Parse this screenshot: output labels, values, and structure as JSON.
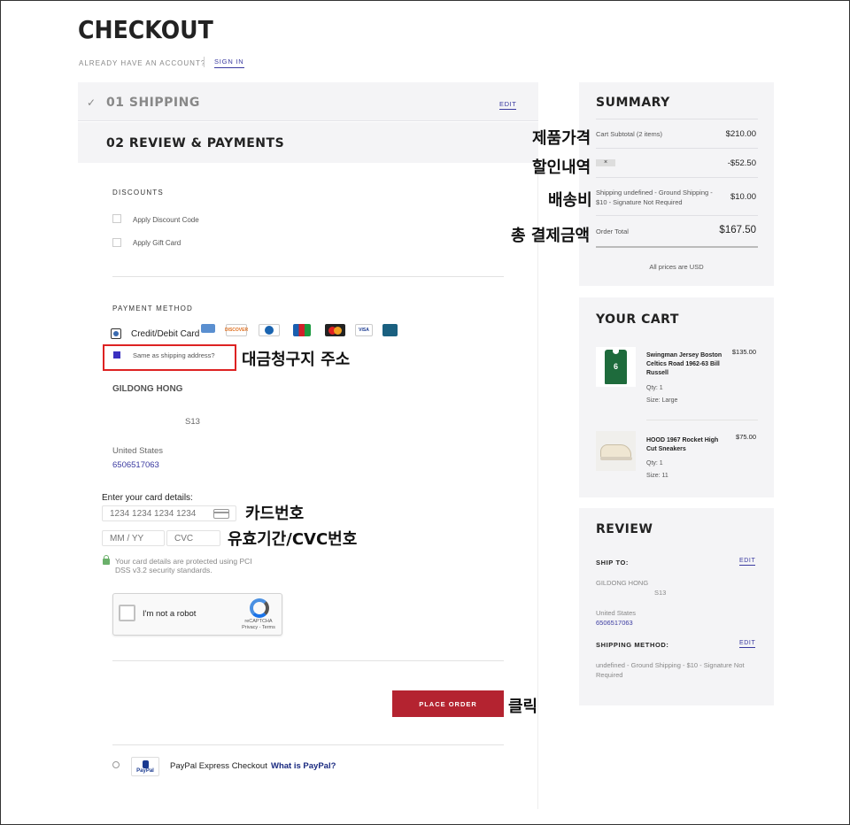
{
  "header": {
    "title": "CHECKOUT",
    "account_question": "ALREADY HAVE AN ACCOUNT?",
    "sign_in": "SIGN IN"
  },
  "steps": {
    "shipping": {
      "title": "01 SHIPPING",
      "edit": "EDIT"
    },
    "review": {
      "title": "02 REVIEW & PAYMENTS"
    }
  },
  "discounts": {
    "label": "DISCOUNTS",
    "options": [
      "Apply Discount Code",
      "Apply Gift Card"
    ]
  },
  "payment": {
    "label": "PAYMENT METHOD",
    "card_option": "Credit/Debit Card",
    "card_logos": [
      "amex",
      "DISCOVER",
      "diners",
      "jcb",
      "mastercard",
      "VISA",
      "cb"
    ],
    "same_as_shipping": "Same as shipping address?",
    "billing": {
      "name": "GILDONG HONG",
      "line": "S13",
      "country": "United States",
      "phone": "6506517063"
    },
    "card_details_label": "Enter your card details:",
    "card_number_placeholder": "1234 1234 1234 1234",
    "expiry_placeholder": "MM / YY",
    "cvc_placeholder": "CVC",
    "secure_text": "Your card details are protected using PCI DSS v3.2 security standards.",
    "captcha": {
      "label": "I'm not a robot",
      "brand": "reCAPTCHA",
      "links": "Privacy - Terms"
    },
    "place_order": "PLACE ORDER",
    "paypal": {
      "logo": "PayPal",
      "label": "PayPal Express Checkout",
      "link": "What is PayPal?"
    }
  },
  "summary": {
    "title": "SUMMARY",
    "rows": [
      {
        "label": "Cart Subtotal (2 items)",
        "value": "$210.00"
      },
      {
        "label": "×",
        "value": "-$52.50"
      },
      {
        "label": "Shipping undefined - Ground Shipping - $10 - Signature Not Required",
        "value": "$10.00"
      },
      {
        "label": "Order Total",
        "value": "$167.50"
      }
    ],
    "note": "All prices are USD"
  },
  "cart": {
    "title": "YOUR CART",
    "items": [
      {
        "name": "Swingman Jersey Boston Celtics Road 1962-63 Bill Russell",
        "price": "$135.00",
        "qty": "Qty: 1",
        "size": "Size: Large",
        "jersey_number": "6"
      },
      {
        "name": "HOOD 1967 Rocket High Cut Sneakers",
        "price": "$75.00",
        "qty": "Qty: 1",
        "size": "Size: 11"
      }
    ]
  },
  "review_panel": {
    "title": "REVIEW",
    "ship_to_label": "SHIP TO:",
    "edit": "EDIT",
    "ship_name": "GILDONG HONG",
    "ship_line": "S13",
    "ship_country": "United States",
    "ship_phone": "6506517063",
    "method_label": "SHIPPING METHOD:",
    "method_text": "undefined - Ground Shipping - $10 - Signature Not Required"
  },
  "annotations": {
    "product_price": "제품가격",
    "discount": "할인내역",
    "shipping_fee": "배송비",
    "total": "총 결제금액",
    "billing_address": "대금청구지 주소",
    "card_number": "카드번호",
    "expiry_cvc": "유효기간/CVC번호",
    "click": "클릭"
  }
}
